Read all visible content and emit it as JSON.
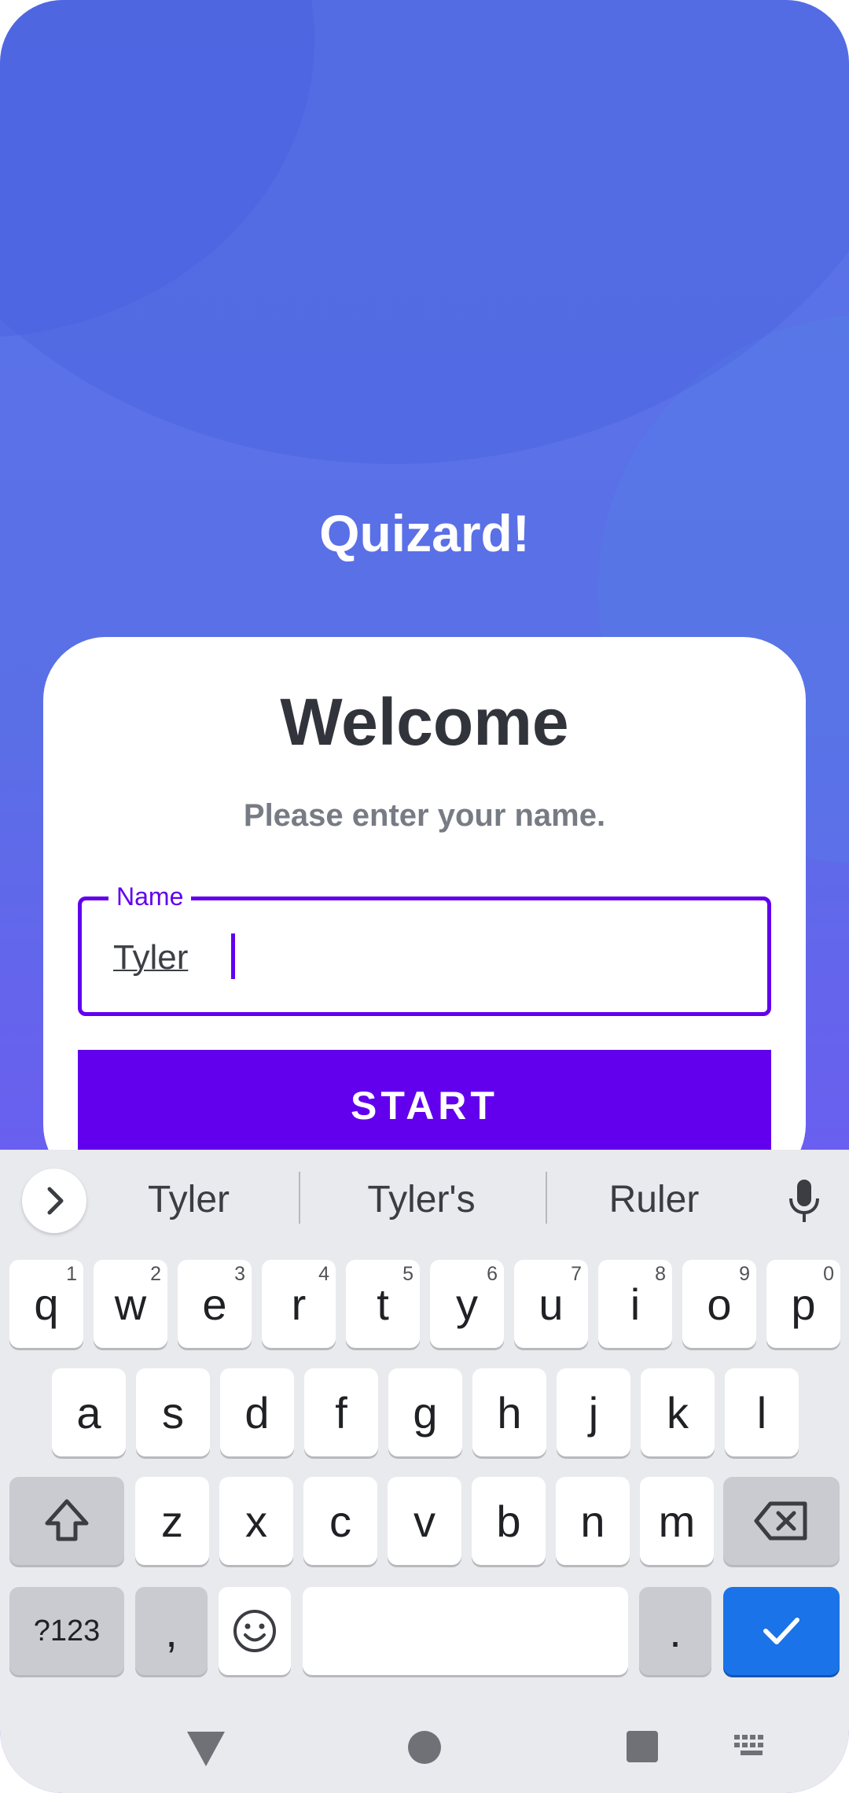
{
  "app": {
    "title": "Quizard!"
  },
  "card": {
    "heading": "Welcome",
    "prompt": "Please enter your name.",
    "name_field": {
      "label": "Name",
      "value": "Tyler"
    },
    "start_label": "START"
  },
  "keyboard": {
    "suggestions": [
      "Tyler",
      "Tyler's",
      "Ruler"
    ],
    "row1": [
      {
        "k": "q",
        "h": "1"
      },
      {
        "k": "w",
        "h": "2"
      },
      {
        "k": "e",
        "h": "3"
      },
      {
        "k": "r",
        "h": "4"
      },
      {
        "k": "t",
        "h": "5"
      },
      {
        "k": "y",
        "h": "6"
      },
      {
        "k": "u",
        "h": "7"
      },
      {
        "k": "i",
        "h": "8"
      },
      {
        "k": "o",
        "h": "9"
      },
      {
        "k": "p",
        "h": "0"
      }
    ],
    "row2": [
      "a",
      "s",
      "d",
      "f",
      "g",
      "h",
      "j",
      "k",
      "l"
    ],
    "row3": [
      "z",
      "x",
      "c",
      "v",
      "b",
      "n",
      "m"
    ],
    "symbols_label": "?123",
    "comma_label": ",",
    "period_label": ".",
    "icons": {
      "expand": "chevron-right-icon",
      "mic": "microphone-icon",
      "shift": "shift-icon",
      "backspace": "backspace-icon",
      "emoji": "emoji-icon",
      "enter": "checkmark-icon"
    }
  },
  "navbar": {
    "icons": [
      "back-triangle-icon",
      "home-circle-icon",
      "recents-square-icon",
      "keyboard-switch-icon"
    ]
  },
  "colors": {
    "primary": "#6200ee",
    "enter_key": "#1a73e8",
    "heading_text": "#32343b",
    "prompt_text": "#777b84"
  }
}
